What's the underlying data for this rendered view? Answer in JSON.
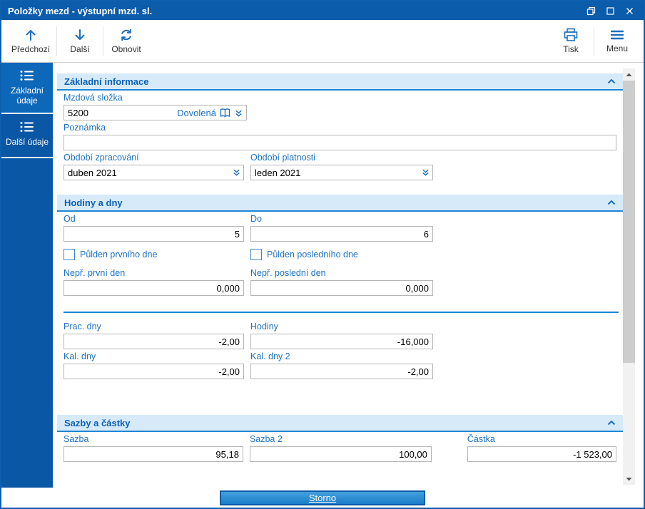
{
  "window": {
    "title": "Položky mezd - výstupní mzd. sl."
  },
  "toolbar": {
    "left": [
      {
        "label": "Předchozí",
        "icon": "arrow-up"
      },
      {
        "label": "Další",
        "icon": "arrow-down"
      },
      {
        "label": "Obnovit",
        "icon": "refresh"
      }
    ],
    "right": [
      {
        "label": "Tisk",
        "icon": "printer"
      },
      {
        "label": "Menu",
        "icon": "hamburger"
      }
    ]
  },
  "sidebar": {
    "items": [
      {
        "label": "Základní údaje",
        "active": true
      },
      {
        "label": "Další údaje",
        "active": false
      }
    ]
  },
  "section_basic": {
    "title": "Základní informace",
    "wage_component": {
      "label": "Mzdová složka",
      "code": "5200",
      "name": "Dovolená"
    },
    "note": {
      "label": "Poznámka",
      "value": ""
    },
    "processing_period": {
      "label": "Období zpracování",
      "value": "duben 2021"
    },
    "validity_period": {
      "label": "Období platnosti",
      "value": "leden 2021"
    }
  },
  "section_hours": {
    "title": "Hodiny a dny",
    "od": {
      "label": "Od",
      "value": "5"
    },
    "do": {
      "label": "Do",
      "value": "6"
    },
    "pulden_prvniho": {
      "label": "Půlden prvního dne",
      "checked": false
    },
    "pulden_posledniho": {
      "label": "Půlden posledního dne",
      "checked": false
    },
    "nepr_prvni": {
      "label": "Nepř. první den",
      "value": "0,000"
    },
    "nepr_posledni": {
      "label": "Nepř. poslední den",
      "value": "0,000"
    },
    "prac_dny": {
      "label": "Prac. dny",
      "value": "-2,00"
    },
    "hodiny": {
      "label": "Hodiny",
      "value": "-16,000"
    },
    "kal_dny": {
      "label": "Kal. dny",
      "value": "-2,00"
    },
    "kal_dny_2": {
      "label": "Kal. dny 2",
      "value": "-2,00"
    }
  },
  "section_rates": {
    "title": "Sazby a částky",
    "sazba": {
      "label": "Sazba",
      "value": "95,18"
    },
    "sazba_2": {
      "label": "Sazba 2",
      "value": "100,00"
    },
    "castka": {
      "label": "Částka",
      "value": "-1 523,00"
    }
  },
  "footer": {
    "storno": "Storno"
  },
  "colors": {
    "titlebar": "#0b5cab",
    "sidebar": "#0a57a5",
    "section_header_bg": "#d7eafa",
    "accent_blue": "#1e87d5",
    "label_blue": "#1b72c5"
  }
}
